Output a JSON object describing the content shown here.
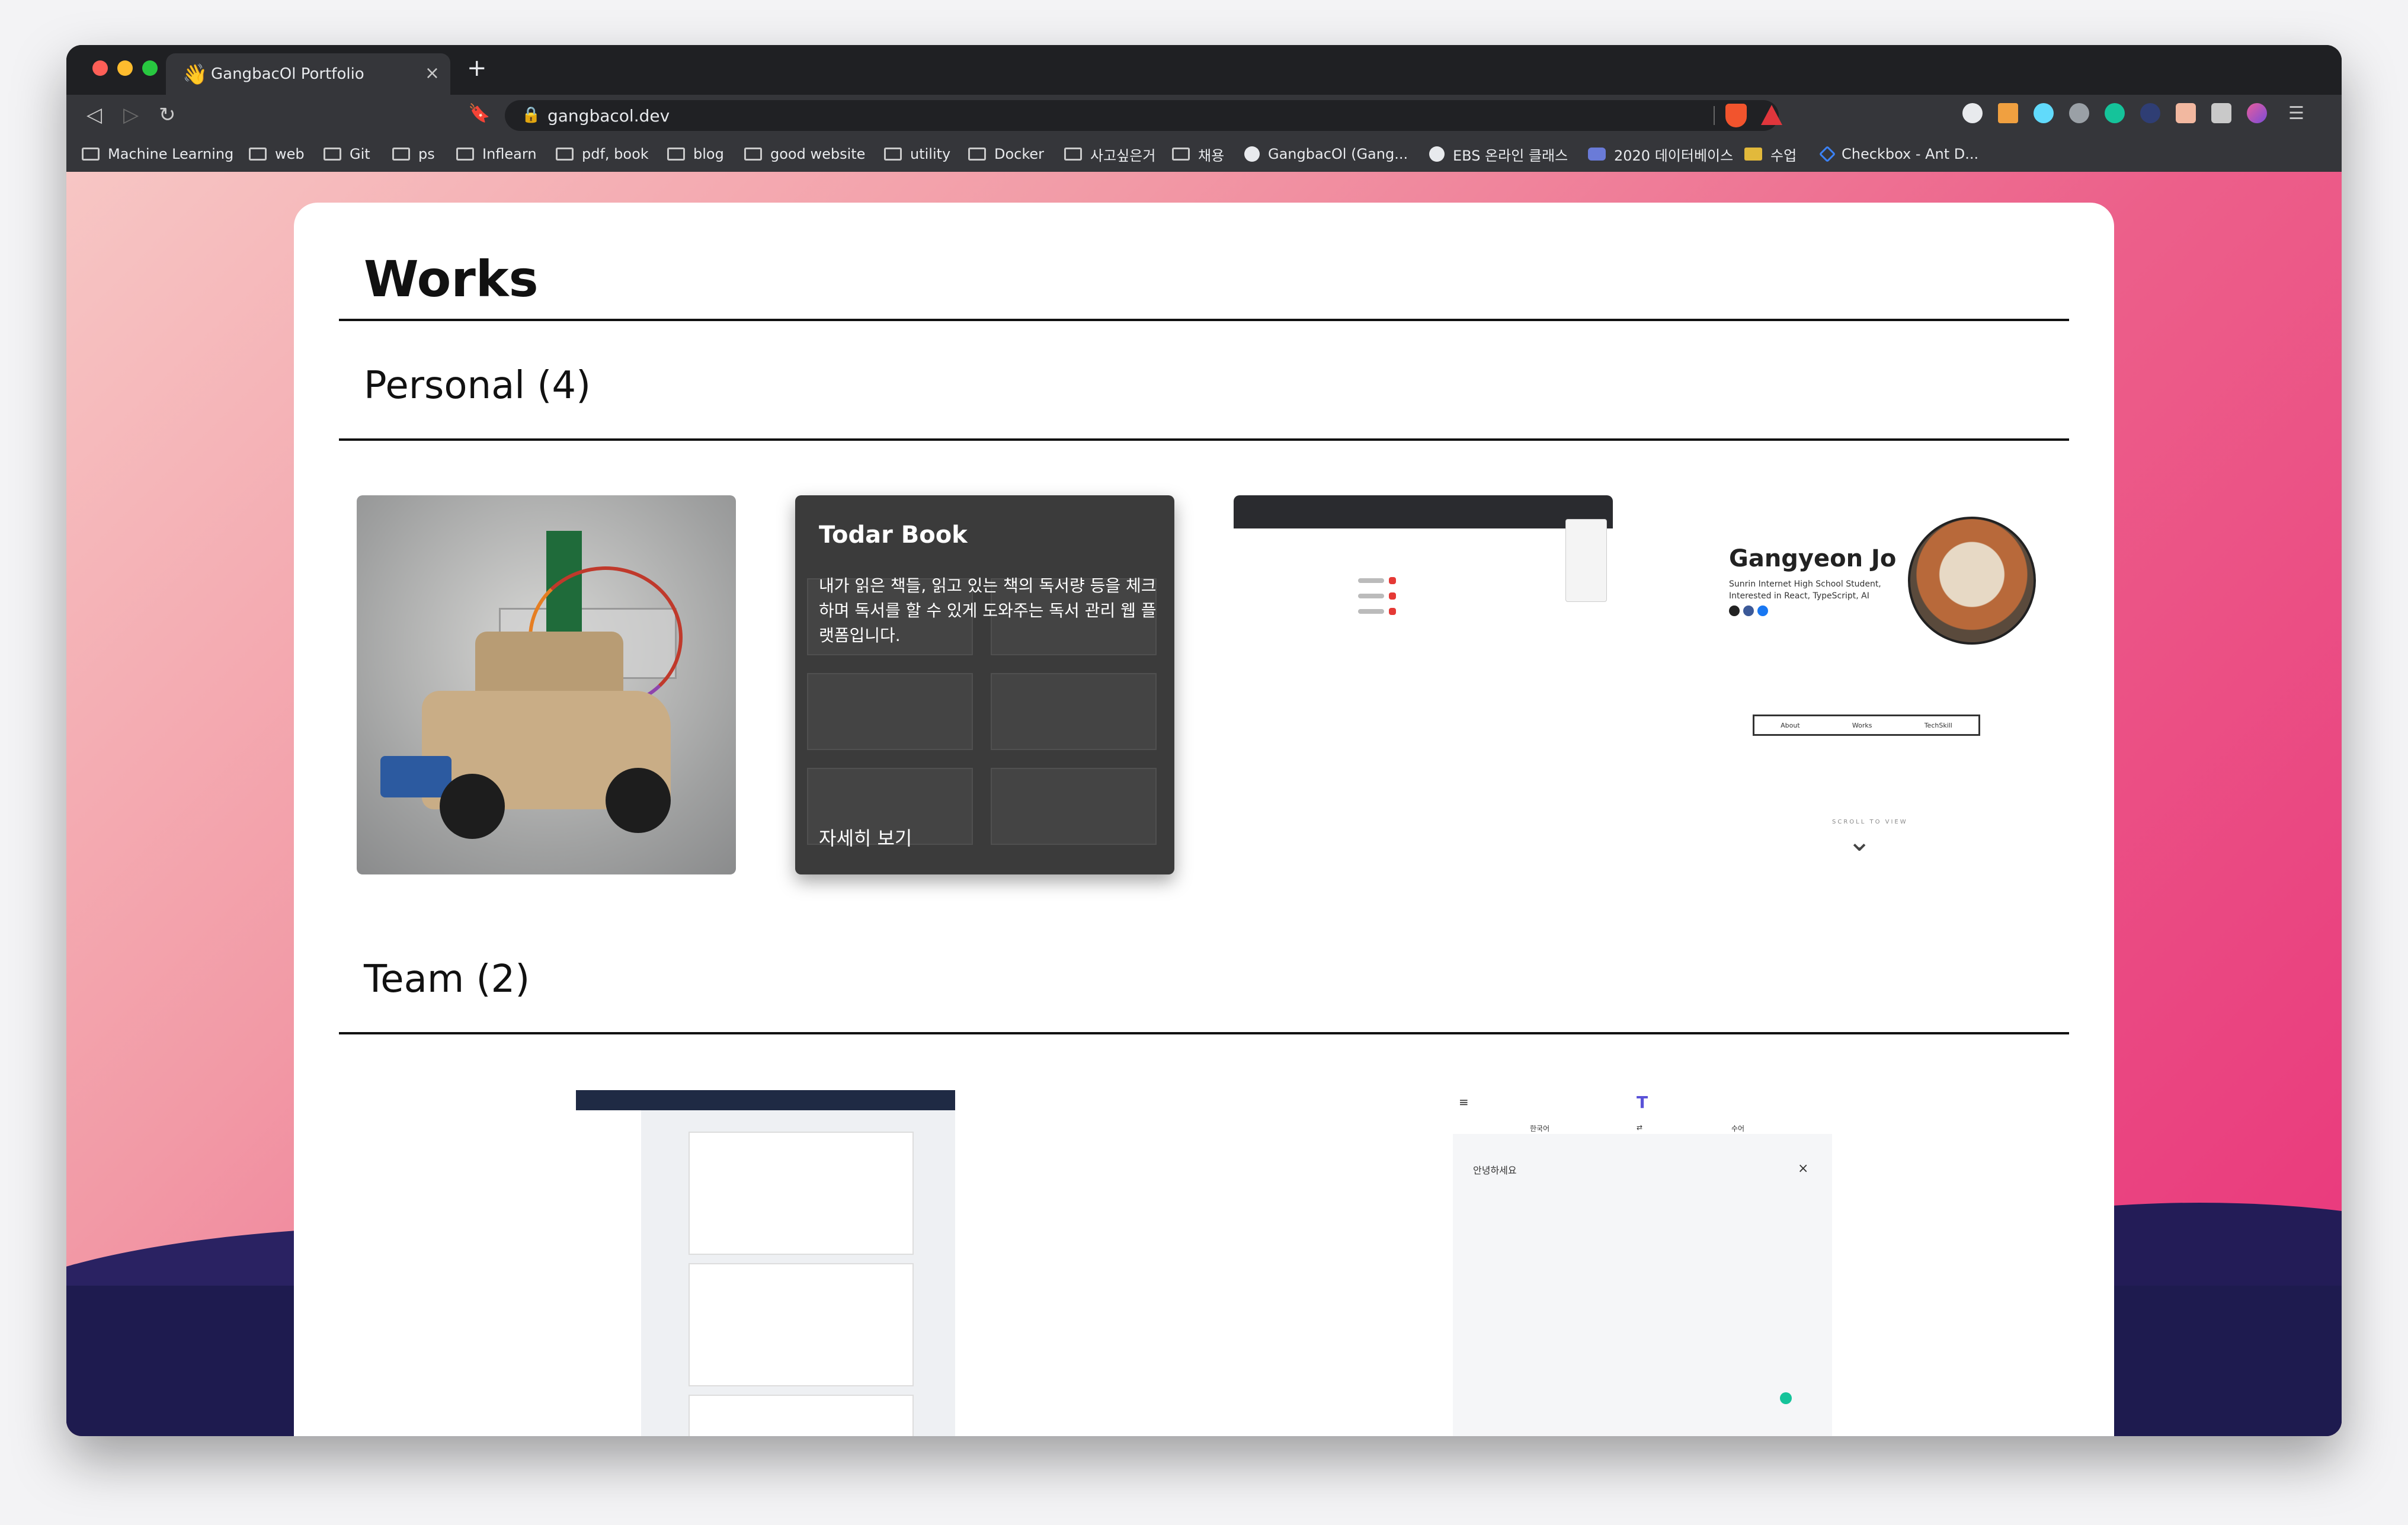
{
  "browser": {
    "tab_title": "GangbacOl Portfolio",
    "tab_close": "×",
    "new_tab": "+",
    "url": "gangbacol.dev",
    "bookmarks": [
      {
        "label": "Machine Learning",
        "icon": "folder-icon"
      },
      {
        "label": "web",
        "icon": "folder-icon"
      },
      {
        "label": "Git",
        "icon": "folder-icon"
      },
      {
        "label": "ps",
        "icon": "folder-icon"
      },
      {
        "label": "Inflearn",
        "icon": "folder-icon"
      },
      {
        "label": "pdf, book",
        "icon": "folder-icon"
      },
      {
        "label": "blog",
        "icon": "folder-icon"
      },
      {
        "label": "good website",
        "icon": "folder-icon"
      },
      {
        "label": "utility",
        "icon": "folder-icon"
      },
      {
        "label": "Docker",
        "icon": "folder-icon"
      },
      {
        "label": "사고싶은거",
        "icon": "folder-icon"
      },
      {
        "label": "채용",
        "icon": "folder-icon"
      },
      {
        "label": "GangbacOl (Gang...",
        "icon": "github-icon"
      },
      {
        "label": "EBS 온라인 클래스",
        "icon": "globe-icon"
      },
      {
        "label": "2020 데이터베이스",
        "icon": "course-icon"
      },
      {
        "label": "수업",
        "icon": "classroom-icon"
      },
      {
        "label": "Checkbox - Ant D...",
        "icon": "ant-design-icon"
      }
    ]
  },
  "page": {
    "heading": "Works",
    "personal_heading": "Personal (4)",
    "team_heading": "Team (2)",
    "personal_works": [
      {
        "kind": "photo",
        "icon": "robot-car-image"
      },
      {
        "kind": "hover",
        "title": "Todar Book",
        "description": "내가 읽은 책들, 읽고 있는 책의 독서량 등을 체크하며 독서를 할 수 있게 도와주는 독서 관리 웹 플랫폼입니다.",
        "more": "자세히 보기"
      },
      {
        "kind": "screenshot",
        "icon": "extension-screenshot"
      },
      {
        "kind": "portfolio",
        "name": "Gangyeon Jo",
        "subtitle": "Sunrin Internet High School Student, Interested in React, TypeScript, AI",
        "menu": [
          "About",
          "Works",
          "TechSkill"
        ],
        "scroll": "SCROLL TO VIEW"
      }
    ],
    "team_works": [
      {
        "kind": "screenshot",
        "icon": "dashboard-screenshot"
      },
      {
        "kind": "translator",
        "langs": [
          "한국어",
          "수어"
        ],
        "greeting": "안녕하세요",
        "close": "×"
      }
    ]
  }
}
